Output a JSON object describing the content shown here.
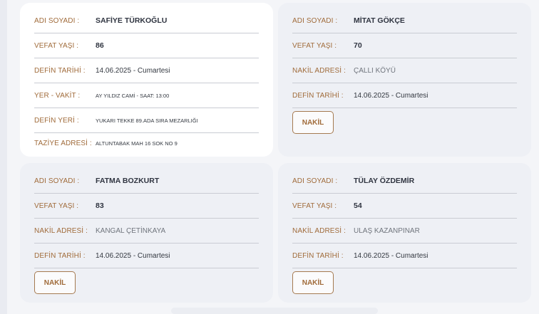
{
  "cards": [
    {
      "rows": [
        {
          "label": "ADI SOYADI :",
          "value": "SAFİYE TÜRKOĞLU"
        },
        {
          "label": "VEFAT YAŞI :",
          "value": "86"
        },
        {
          "label": "DEFİN TARİHİ :",
          "value": "14.06.2025 - Cumartesi"
        },
        {
          "label": "YER - VAKİT :",
          "value": "AY YILDIZ CAMİ - SAAT: 13:00"
        },
        {
          "label": "DEFİN YERİ :",
          "value": "YUKARI TEKKE 89.ADA SIRA MEZARLIĞI"
        },
        {
          "label": "TAZİYE ADRESİ :",
          "value": "ALTUNTABAK MAH 16 SOK NO 9"
        }
      ]
    },
    {
      "rows": [
        {
          "label": "ADI SOYADI :",
          "value": "MİTAT GÖKÇE"
        },
        {
          "label": "VEFAT YAŞI :",
          "value": "70"
        },
        {
          "label": "NAKİL ADRESİ :",
          "value": "ÇALLI KÖYÜ"
        },
        {
          "label": "DEFİN TARİHİ :",
          "value": "14.06.2025 - Cumartesi"
        }
      ],
      "button": "NAKİL"
    },
    {
      "rows": [
        {
          "label": "ADI SOYADI :",
          "value": "FATMA BOZKURT"
        },
        {
          "label": "VEFAT YAŞI :",
          "value": "83"
        },
        {
          "label": "NAKİL ADRESİ :",
          "value": "KANGAL ÇETİNKAYA"
        },
        {
          "label": "DEFİN TARİHİ :",
          "value": "14.06.2025 - Cumartesi"
        }
      ],
      "button": "NAKİL"
    },
    {
      "rows": [
        {
          "label": "ADI SOYADI :",
          "value": "TÜLAY ÖZDEMİR"
        },
        {
          "label": "VEFAT YAŞI :",
          "value": "54"
        },
        {
          "label": "NAKİL ADRESİ :",
          "value": "ULAŞ KAZANPINAR"
        },
        {
          "label": "DEFİN TARİHİ :",
          "value": "14.06.2025 - Cumartesi"
        }
      ],
      "button": "NAKİL"
    }
  ],
  "colors": {
    "label": "#a06b3a",
    "value": "#333840",
    "button_border": "#a57a51"
  }
}
